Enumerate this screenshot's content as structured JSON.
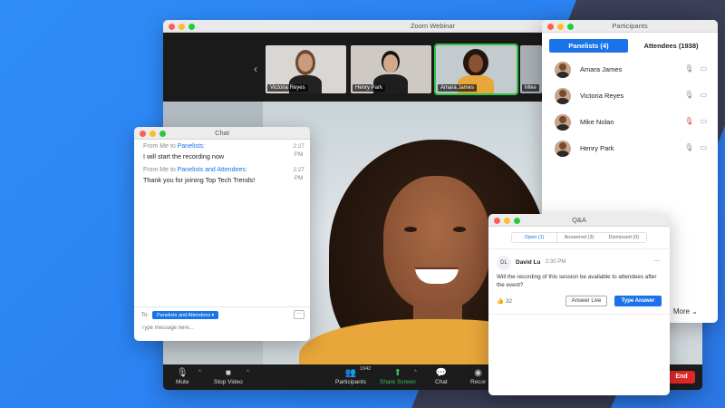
{
  "main": {
    "title": "Zoom Webinar",
    "thumbnails": [
      {
        "name": "Victoria Reyes",
        "bg": "#d9d6d3",
        "skin": "#c99a7c",
        "hair": "#6d4a2f",
        "shirt": "#222222"
      },
      {
        "name": "Henry Park",
        "bg": "#cfc9c4",
        "skin": "#d3a98c",
        "hair": "#151515",
        "shirt": "#1e1e1e"
      },
      {
        "name": "Amara James",
        "bg": "#c4cbcf",
        "skin": "#8a5234",
        "hair": "#24150d",
        "shirt": "#e9a63a"
      },
      {
        "name": "Mike",
        "bg": "#a9b1b6",
        "skin": "#c9a48a",
        "hair": "#3a2a1f",
        "shirt": "#333333"
      }
    ],
    "controls": {
      "mute": "Mute",
      "stop_video": "Stop Video",
      "participants": "Participants",
      "participants_count": "1942",
      "share_screen": "Share Screen",
      "chat": "Chat",
      "record": "Recor",
      "end": "End"
    }
  },
  "participants": {
    "title": "Participants",
    "tab_panelists": "Panelists (4)",
    "tab_attendees": "Attendees (1938)",
    "list": [
      {
        "name": "Amara James",
        "muted": false
      },
      {
        "name": "Victoria Reyes",
        "muted": false
      },
      {
        "name": "Mike Nolan",
        "muted": true
      },
      {
        "name": "Henry Park",
        "muted": false
      }
    ],
    "more": "More ⌄"
  },
  "chat": {
    "title": "Chat",
    "messages": [
      {
        "from": "From Me to ",
        "to": "Panelists:",
        "text": "I will start the recording now",
        "time_h": "2:27",
        "time_p": "PM"
      },
      {
        "from": "From Me to ",
        "to": "Panelists and Attendees:",
        "text": "Thank you for joining Top Tech Trends!",
        "time_h": "2:27",
        "time_p": "PM"
      }
    ],
    "to_label": "To:",
    "to_value": "Panelists and Attendees ▾",
    "placeholder": "Type message here...",
    "dots": "···"
  },
  "qa": {
    "title": "Q&A",
    "tabs": [
      "Open (1)",
      "Answered (3)",
      "Dismissed (0)"
    ],
    "initials": "DL",
    "name": "David Lu",
    "time": "2:30 PM",
    "menu": "···",
    "question": "Will the recording of this session be available to attendees after the event?",
    "likes": "32",
    "answer_live": "Answer Live",
    "type_answer": "Type Answer"
  },
  "colors": {
    "accent": "#1a73e8",
    "end": "#e02828",
    "share": "#36c256"
  }
}
